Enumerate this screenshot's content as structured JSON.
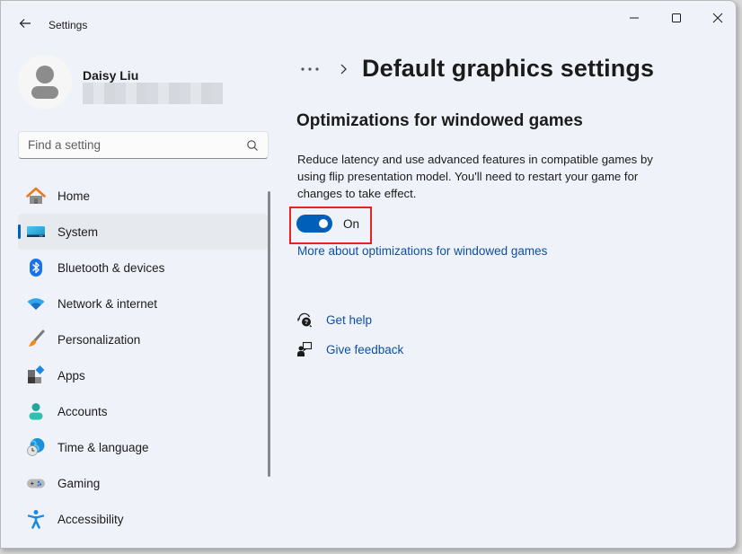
{
  "window": {
    "app_title": "Settings",
    "controls": {
      "minimize": "minimize-icon",
      "maximize": "maximize-icon",
      "close": "close-icon"
    }
  },
  "profile": {
    "name": "Daisy Liu",
    "email_redacted": true
  },
  "search": {
    "placeholder": "Find a setting",
    "value": ""
  },
  "sidebar": {
    "items": [
      {
        "label": "Home",
        "icon": "home-icon",
        "active": false
      },
      {
        "label": "System",
        "icon": "system-icon",
        "active": true
      },
      {
        "label": "Bluetooth & devices",
        "icon": "bluetooth-icon",
        "active": false
      },
      {
        "label": "Network & internet",
        "icon": "wifi-icon",
        "active": false
      },
      {
        "label": "Personalization",
        "icon": "paintbrush-icon",
        "active": false
      },
      {
        "label": "Apps",
        "icon": "apps-icon",
        "active": false
      },
      {
        "label": "Accounts",
        "icon": "account-icon",
        "active": false
      },
      {
        "label": "Time & language",
        "icon": "globe-clock-icon",
        "active": false
      },
      {
        "label": "Gaming",
        "icon": "gamepad-icon",
        "active": false
      },
      {
        "label": "Accessibility",
        "icon": "accessibility-icon",
        "active": false
      }
    ]
  },
  "main": {
    "breadcrumb_more": "more-icon",
    "page_title": "Default graphics settings",
    "section_title": "Optimizations for windowed games",
    "description": "Reduce latency and use advanced features in compatible games by using flip presentation model. You'll need to restart your game for changes to take effect.",
    "toggle": {
      "state": true,
      "label": "On"
    },
    "more_link": "More about optimizations for windowed games",
    "help_links": [
      {
        "label": "Get help",
        "icon": "help-icon"
      },
      {
        "label": "Give feedback",
        "icon": "feedback-icon"
      }
    ]
  },
  "colors": {
    "accent": "#005fb8",
    "link": "#0f4fa1",
    "highlight_box": "#e52420",
    "background": "#eff3f9"
  }
}
